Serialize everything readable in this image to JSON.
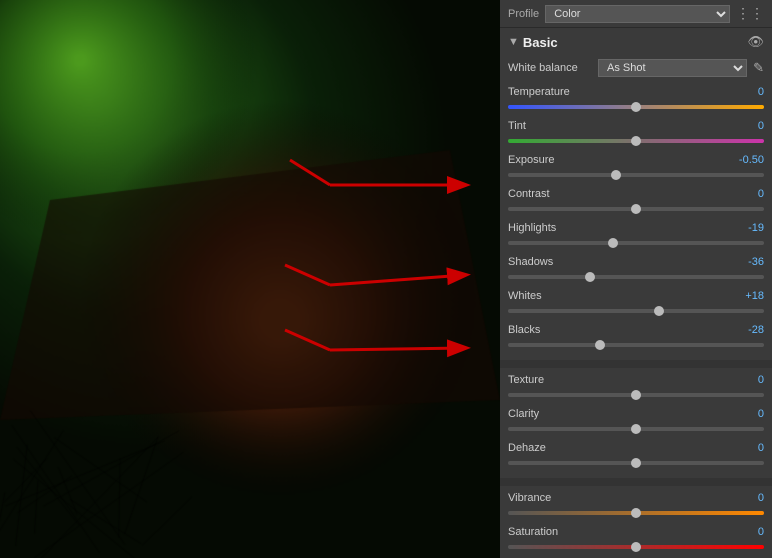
{
  "photo": {
    "alt": "Macro insect photo"
  },
  "panel": {
    "profile_label": "Profile",
    "profile_value": "Color",
    "section_basic": "Basic",
    "white_balance_label": "White balance",
    "white_balance_value": "As Shot",
    "sliders": [
      {
        "label": "Temperature",
        "value": "0",
        "track": "track-temp",
        "thumb_pct": 50,
        "positive": false
      },
      {
        "label": "Tint",
        "value": "0",
        "track": "track-tint",
        "thumb_pct": 50,
        "positive": false
      },
      {
        "label": "Exposure",
        "value": "-0.50",
        "track": "track-neutral",
        "thumb_pct": 42,
        "positive": false
      },
      {
        "label": "Contrast",
        "value": "0",
        "track": "track-neutral",
        "thumb_pct": 50,
        "positive": false
      },
      {
        "label": "Highlights",
        "value": "-19",
        "track": "track-neutral",
        "thumb_pct": 41,
        "positive": false
      },
      {
        "label": "Shadows",
        "value": "-36",
        "track": "track-neutral",
        "thumb_pct": 32,
        "positive": false
      },
      {
        "label": "Whites",
        "value": "+18",
        "track": "track-neutral",
        "thumb_pct": 59,
        "positive": true
      },
      {
        "label": "Blacks",
        "value": "-28",
        "track": "track-neutral",
        "thumb_pct": 36,
        "positive": false
      }
    ],
    "sliders2": [
      {
        "label": "Texture",
        "value": "0",
        "track": "track-neutral",
        "thumb_pct": 50,
        "positive": false
      },
      {
        "label": "Clarity",
        "value": "0",
        "track": "track-neutral",
        "thumb_pct": 50,
        "positive": false
      },
      {
        "label": "Dehaze",
        "value": "0",
        "track": "track-neutral",
        "thumb_pct": 50,
        "positive": false
      }
    ],
    "sliders3": [
      {
        "label": "Vibrance",
        "value": "0",
        "track": "track-vibrance",
        "thumb_pct": 50,
        "positive": false
      },
      {
        "label": "Saturation",
        "value": "0",
        "track": "track-saturation",
        "thumb_pct": 50,
        "positive": false
      }
    ]
  }
}
